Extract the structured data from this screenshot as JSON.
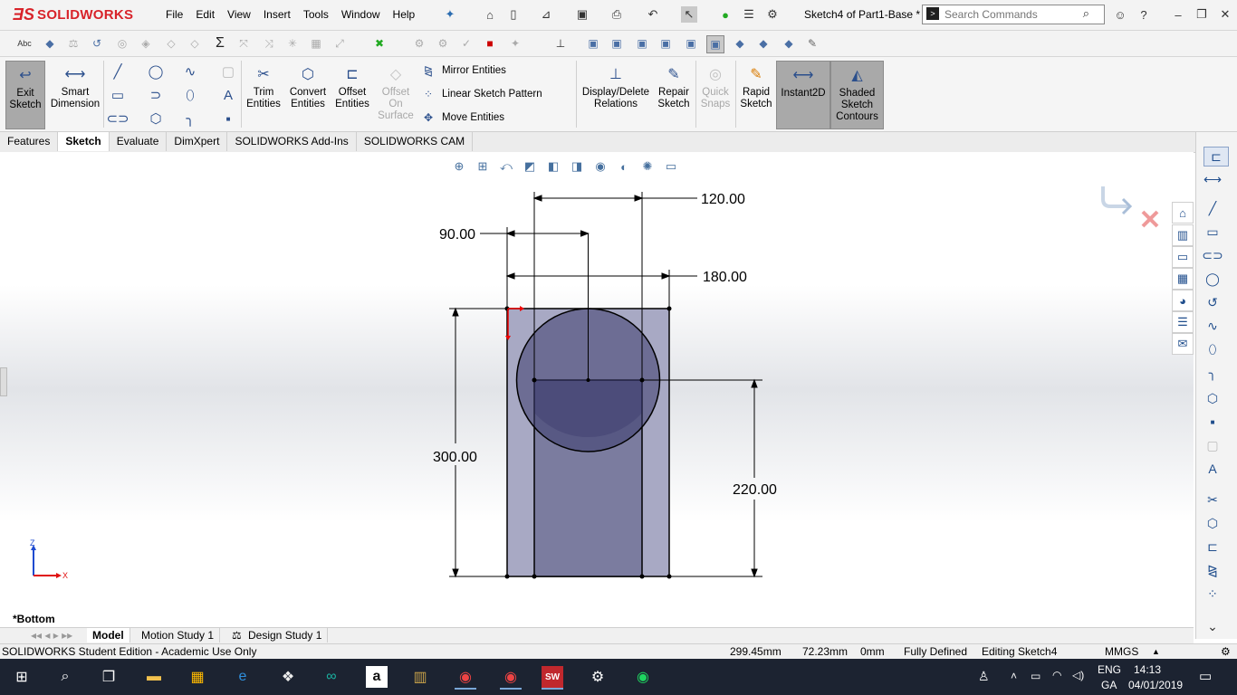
{
  "app": {
    "logo_ds": "ƎS",
    "logo_text": "SOLIDWORKS",
    "doc_title": "Sketch4 of Part1-Base *"
  },
  "menu": [
    "File",
    "Edit",
    "View",
    "Insert",
    "Tools",
    "Window",
    "Help"
  ],
  "search": {
    "placeholder": "Search Commands"
  },
  "command_manager": {
    "exit_sketch": "Exit Sketch",
    "smart_dimension": "Smart Dimension",
    "trim_entities": "Trim Entities",
    "convert_entities": "Convert Entities",
    "offset_entities": "Offset Entities",
    "offset_on_surface": "Offset On Surface",
    "mirror_entities": "Mirror Entities",
    "linear_sketch_pattern": "Linear Sketch Pattern",
    "move_entities": "Move Entities",
    "display_delete_relations": "Display/Delete Relations",
    "repair_sketch": "Repair Sketch",
    "quick_snaps": "Quick Snaps",
    "rapid_sketch": "Rapid Sketch",
    "instant2d": "Instant2D",
    "shaded_sketch_contours": "Shaded Sketch Contours"
  },
  "tabs": [
    "Features",
    "Sketch",
    "Evaluate",
    "DimXpert",
    "SOLIDWORKS Add-Ins",
    "SOLIDWORKS CAM"
  ],
  "active_tab": "Sketch",
  "sketch": {
    "dimensions": {
      "d_top": "120.00",
      "d_left": "90.00",
      "d_width": "180.00",
      "d_height": "300.00",
      "d_right": "220.00"
    },
    "triad": {
      "z": "Z",
      "x": "X"
    }
  },
  "view_label": "*Bottom",
  "bottom_tabs": {
    "model": "Model",
    "motion": "Motion Study 1",
    "design": "Design Study 1"
  },
  "status": {
    "edition": "SOLIDWORKS Student Edition - Academic Use Only",
    "x": "299.45mm",
    "y": "72.23mm",
    "z": "0mm",
    "defined": "Fully Defined",
    "editing": "Editing Sketch4",
    "units": "MMGS"
  },
  "taskbar": {
    "lang1": "ENG",
    "lang2": "GA",
    "time": "14:13",
    "date": "04/01/2019"
  },
  "colors": {
    "accent": "#d8232a",
    "taskbar": "#1c2331",
    "sketch_fill": "#7d7e9e",
    "circle_fill": "#4b4c7c"
  }
}
